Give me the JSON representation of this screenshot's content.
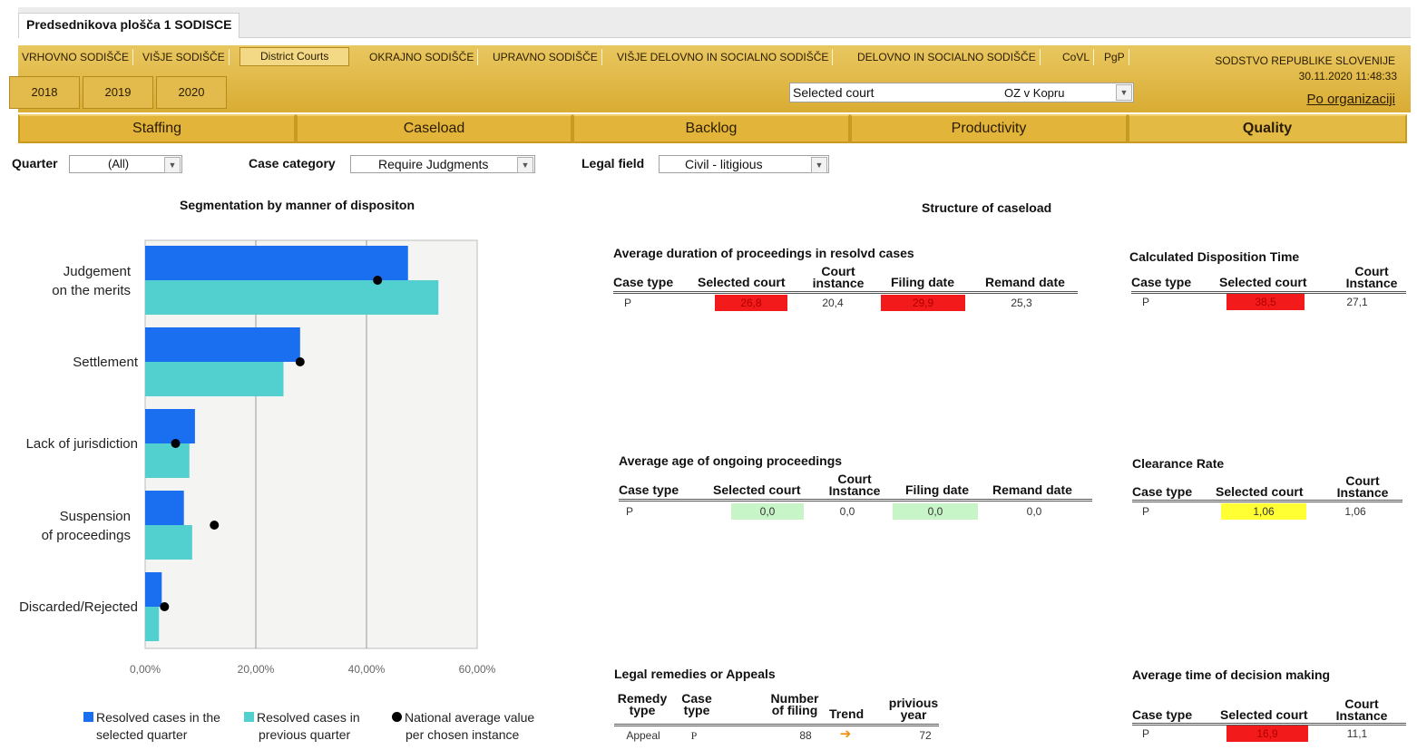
{
  "window": {
    "title": "Predsednikova plošča 1 SODISCE"
  },
  "court_tabs": [
    {
      "label": "VRHOVNO SODIŠČE",
      "x": 20
    },
    {
      "label": "VIŠJE SODIŠČE",
      "x": 153
    },
    {
      "label": "District Courts",
      "active": true
    },
    {
      "label": "OKRAJNO SODIŠČE"
    },
    {
      "label": "UPRAVNO SODIŠČE"
    },
    {
      "label": "VIŠJE DELOVNO IN SOCIALNO SODIŠČE"
    },
    {
      "label": "DELOVNO IN SOCIALNO SODIŠČE"
    },
    {
      "label": "CoVL"
    },
    {
      "label": "PgP"
    }
  ],
  "years": [
    "2018",
    "2019",
    "2020"
  ],
  "selected_court": {
    "label": "Selected court",
    "value": "OZ v Kopru"
  },
  "org": {
    "name": "SODSTVO REPUBLIKE SLOVENIJE",
    "datetime": "30.11.2020 11:48:33",
    "link": "Po organizaciji"
  },
  "nav_tabs": [
    "Staffing",
    "Caseload",
    "Backlog",
    "Productivity",
    "Quality"
  ],
  "filters": {
    "quarter": {
      "label": "Quarter",
      "value": "(All)"
    },
    "case_category": {
      "label": "Case category",
      "value": "Require Judgments"
    },
    "legal_field": {
      "label": "Legal field",
      "value": "Civil - litigious"
    }
  },
  "segmentation_title": "Segmentation by manner of dispositon",
  "structure_title": "Structure of caseload",
  "chart_data": {
    "type": "bar",
    "orientation": "horizontal",
    "title": "Segmentation by manner of dispositon",
    "categories": [
      "Judgement on the merits",
      "Settlement",
      "Lack of jurisdiction",
      "Suspension of proceedings",
      "Discarded/Rejected"
    ],
    "category_lines": [
      [
        "Judgement",
        "on the merits"
      ],
      [
        "Settlement"
      ],
      [
        "Lack of jurisdiction"
      ],
      [
        "Suspension",
        "of proceedings"
      ],
      [
        "Discarded/Rejected"
      ]
    ],
    "series": [
      {
        "name": "Resolved cases in the selected quarter",
        "color": "#1a6ef0",
        "values": [
          47.5,
          28.0,
          9.0,
          7.0,
          3.0
        ]
      },
      {
        "name": "Resolved cases in previous quarter",
        "color": "#52d0d0",
        "values": [
          53.0,
          25.0,
          8.0,
          8.5,
          2.5
        ]
      },
      {
        "name": "National average value per chosen instance",
        "color": "#000000",
        "values": [
          42.0,
          28.0,
          5.5,
          12.5,
          3.5
        ],
        "marker": "dot"
      }
    ],
    "xlim": [
      0,
      60
    ],
    "xticks": [
      "0,00%",
      "20,00%",
      "40,00%",
      "60,00%"
    ],
    "grid": true,
    "legend_placement": "bottom"
  },
  "legend": {
    "s1": [
      "Resolved cases in the",
      "selected quarter"
    ],
    "s2": [
      "Resolved cases in",
      "previous quarter"
    ],
    "s3": [
      "National average value",
      "per chosen instance"
    ]
  },
  "duration": {
    "title": "Average duration of proceedings in resolvd cases",
    "headers": [
      "Case type",
      "Selected court",
      "Court instance",
      "Filing date",
      "Remand date"
    ],
    "row": [
      "P",
      "26,8",
      "20,4",
      "29,9",
      "25,3"
    ]
  },
  "cdt": {
    "title": "Calculated Disposition Time",
    "headers": [
      "Case type",
      "Selected court",
      "Court Instance"
    ],
    "row": [
      "P",
      "38,5",
      "27,1"
    ]
  },
  "age": {
    "title": "Average age of ongoing proceedings",
    "headers": [
      "Case type",
      "Selected court",
      "Court Instance",
      "Filing date",
      "Remand date"
    ],
    "row": [
      "P",
      "0,0",
      "0,0",
      "0,0",
      "0,0"
    ]
  },
  "clearance": {
    "title": "Clearance Rate",
    "headers": [
      "Case type",
      "Selected court",
      "Court Instance"
    ],
    "row": [
      "P",
      "1,06",
      "1,06"
    ]
  },
  "remedies": {
    "title": "Legal remedies or Appeals",
    "headers": [
      "Remedy type",
      "Case type",
      "Number of filing",
      "Trend",
      "privious year"
    ],
    "row": [
      "Appeal",
      "P",
      "88",
      "72"
    ]
  },
  "decision": {
    "title": "Average time of decision making",
    "headers": [
      "Case type",
      "Selected court",
      "Court Instance"
    ],
    "row": [
      "P",
      "16,9",
      "11,1"
    ]
  }
}
